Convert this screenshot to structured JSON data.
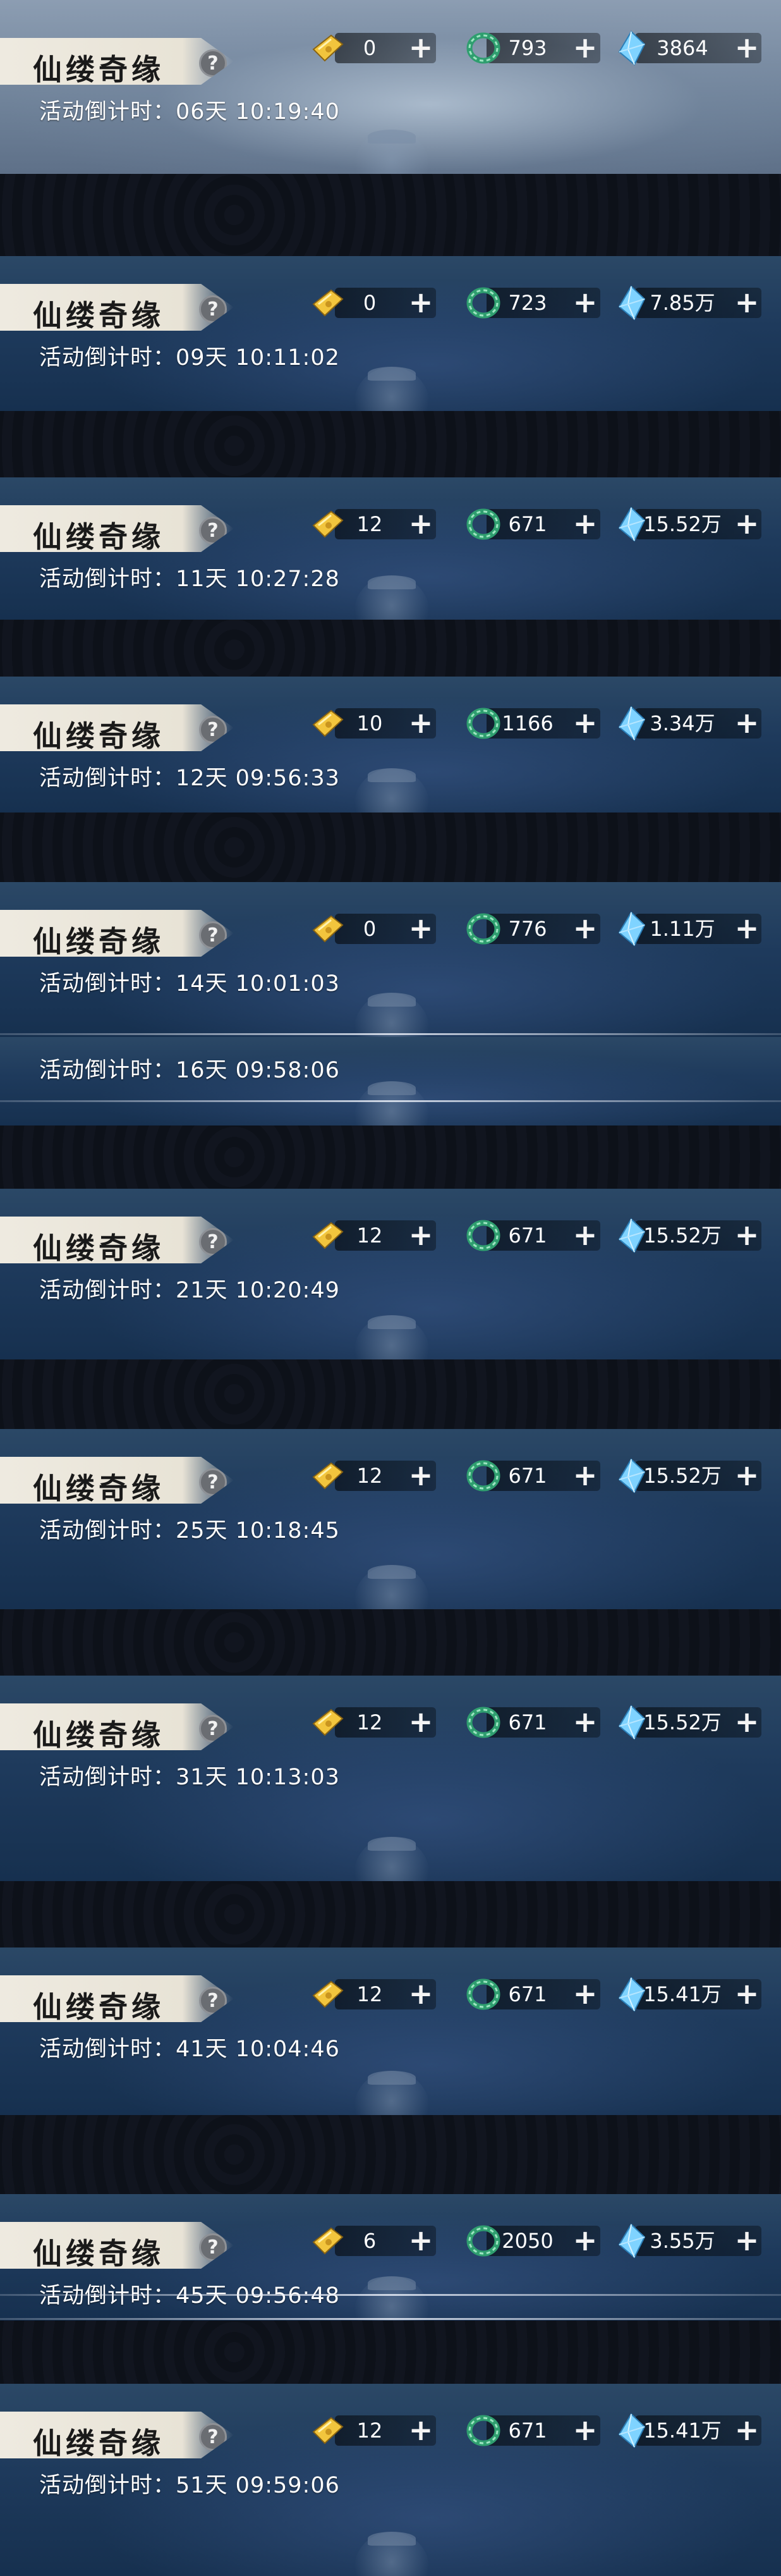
{
  "title": "仙缕奇缘",
  "help_glyph": "?",
  "plus_glyph": "+",
  "icons": {
    "ticket": "gold-ticket-icon",
    "jade": "jade-bracelet-icon",
    "gem": "blue-crystal-icon",
    "help": "help-icon",
    "plus": "plus-icon"
  },
  "colors": {
    "banner": "#eeeae0",
    "panel": "#1e3a5c",
    "gem": "#7fd3ff",
    "jade": "#3bb07f",
    "ticket": "#f2c53d"
  },
  "panels": [
    {
      "countdown": "活动倒计时：06天 10:19:40",
      "ticket": "0",
      "jade": "793",
      "gem": "3864",
      "header": true
    },
    {
      "countdown": "活动倒计时：09天 10:11:02",
      "ticket": "0",
      "jade": "723",
      "gem": "7.85万",
      "header": true
    },
    {
      "countdown": "活动倒计时：11天 10:27:28",
      "ticket": "12",
      "jade": "671",
      "gem": "15.52万",
      "header": true
    },
    {
      "countdown": "活动倒计时：12天 09:56:33",
      "ticket": "10",
      "jade": "1166",
      "gem": "3.34万",
      "header": true
    },
    {
      "countdown": "活动倒计时：14天 10:01:03",
      "ticket": "0",
      "jade": "776",
      "gem": "1.11万",
      "header": true
    },
    {
      "countdown": "活动倒计时：16天 09:58:06",
      "header": false
    },
    {
      "countdown": "活动倒计时：21天 10:20:49",
      "ticket": "12",
      "jade": "671",
      "gem": "15.52万",
      "header": true
    },
    {
      "countdown": "活动倒计时：25天 10:18:45",
      "ticket": "12",
      "jade": "671",
      "gem": "15.52万",
      "header": true
    },
    {
      "countdown": "活动倒计时：31天 10:13:03",
      "ticket": "12",
      "jade": "671",
      "gem": "15.52万",
      "header": true
    },
    {
      "countdown": "活动倒计时：41天 10:04:46",
      "ticket": "12",
      "jade": "671",
      "gem": "15.41万",
      "header": true
    },
    {
      "countdown": "活动倒计时：45天 09:56:48",
      "ticket": "6",
      "jade": "2050",
      "gem": "3.55万",
      "header": true
    },
    {
      "countdown": "活动倒计时：51天 09:59:06",
      "ticket": "12",
      "jade": "671",
      "gem": "15.41万",
      "header": true
    }
  ]
}
